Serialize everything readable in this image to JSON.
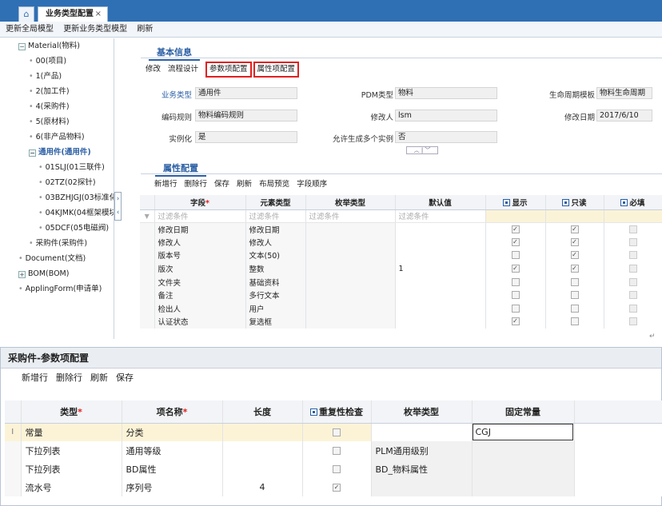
{
  "tabs": {
    "home_icon": "home-icon",
    "main_label": "业务类型配置",
    "close": "×"
  },
  "menubar": [
    "更新全局模型",
    "更新业务类型模型",
    "刷新"
  ],
  "tree": [
    {
      "label": "Material(物料)",
      "level": 0,
      "exp": "⊟"
    },
    {
      "label": "00(项目)",
      "level": 1
    },
    {
      "label": "1(产品)",
      "level": 1
    },
    {
      "label": "2(加工件)",
      "level": 1
    },
    {
      "label": "4(采购件)",
      "level": 1
    },
    {
      "label": "5(原材料)",
      "level": 1
    },
    {
      "label": "6(非产品物料)",
      "level": 1
    },
    {
      "label": "通用件(通用件)",
      "level": 1,
      "exp": "⊟",
      "sel": true
    },
    {
      "label": "01SLJ(01三联件)",
      "level": 2
    },
    {
      "label": "02TZ(02探针)",
      "level": 2
    },
    {
      "label": "03BZHJGJ(03标准化",
      "level": 2
    },
    {
      "label": "04KJMK(04框架模块",
      "level": 2
    },
    {
      "label": "05DCF(05电磁阀)",
      "level": 2
    },
    {
      "label": "采购件(采购件)",
      "level": 1
    },
    {
      "label": "Document(文档)",
      "level": 0
    },
    {
      "label": "BOM(BOM)",
      "level": 0,
      "exp": "⊞"
    },
    {
      "label": "ApplingForm(申请单)",
      "level": 0
    }
  ],
  "collapse": {
    "top": "›",
    "bottom": "‹"
  },
  "basic": {
    "title": "基本信息",
    "buttons": [
      "修改",
      "流程设计"
    ],
    "boxed": [
      "参数项配置",
      "属性项配置"
    ],
    "fields": {
      "biz_type": {
        "label": "业务类型",
        "value": "通用件"
      },
      "pdm_type": {
        "label": "PDM类型",
        "value": "物料"
      },
      "lifecycle": {
        "label": "生命周期模板",
        "value": "物料生命周期"
      },
      "code_rule": {
        "label": "编码规则",
        "value": "物料编码规则"
      },
      "modifier": {
        "label": "修改人",
        "value": "lsm"
      },
      "mod_date": {
        "label": "修改日期",
        "value": "2017/6/10"
      },
      "instantiate": {
        "label": "实例化",
        "value": "是"
      },
      "multi": {
        "label": "允许生成多个实例",
        "value": "否"
      }
    },
    "updown": "︿ | ﹀"
  },
  "attr": {
    "title": "属性配置",
    "buttons": [
      "新增行",
      "删除行",
      "保存",
      "刷新",
      "布局预览",
      "字段顺序"
    ],
    "columns": [
      "字段",
      "元素类型",
      "枚举类型",
      "默认值",
      "显示",
      "只读",
      "必填"
    ],
    "filter_text": "过滤条件",
    "rows": [
      {
        "field": "修改日期",
        "type": "修改日期",
        "enum": "",
        "default": "",
        "show": true,
        "ro": true,
        "req": false
      },
      {
        "field": "修改人",
        "type": "修改人",
        "enum": "",
        "default": "",
        "show": true,
        "ro": true,
        "req": false
      },
      {
        "field": "版本号",
        "type": "文本(50)",
        "enum": "",
        "default": "",
        "show": false,
        "ro": true,
        "req": false
      },
      {
        "field": "版次",
        "type": "整数",
        "enum": "",
        "default": "1",
        "show": true,
        "ro": true,
        "req": false
      },
      {
        "field": "文件夹",
        "type": "基础资料",
        "enum": "",
        "default": "",
        "show": false,
        "ro": false,
        "req": false
      },
      {
        "field": "备注",
        "type": "多行文本",
        "enum": "",
        "default": "",
        "show": false,
        "ro": false,
        "req": false
      },
      {
        "field": "检出人",
        "type": "用户",
        "enum": "",
        "default": "",
        "show": false,
        "ro": false,
        "req": false
      },
      {
        "field": "认证状态",
        "type": "复选框",
        "enum": "",
        "default": "",
        "show": true,
        "ro": false,
        "req": false
      }
    ]
  },
  "dialog": {
    "title": "采购件-参数项配置",
    "buttons": [
      "新增行",
      "删除行",
      "刷新",
      "保存"
    ],
    "columns": [
      "类型",
      "项名称",
      "长度",
      "重复性检查",
      "枚举类型",
      "固定常量"
    ],
    "rows": [
      {
        "type": "常量",
        "name": "分类",
        "length": "",
        "dup": false,
        "enum": "",
        "const": "CGJ"
      },
      {
        "type": "下拉列表",
        "name": "通用等级",
        "length": "",
        "dup": false,
        "enum": "PLM通用级别",
        "const": ""
      },
      {
        "type": "下拉列表",
        "name": "BD属性",
        "length": "",
        "dup": false,
        "enum": "BD_物料属性",
        "const": ""
      },
      {
        "type": "流水号",
        "name": "序列号",
        "length": "4",
        "dup": true,
        "enum": "",
        "const": ""
      }
    ]
  }
}
